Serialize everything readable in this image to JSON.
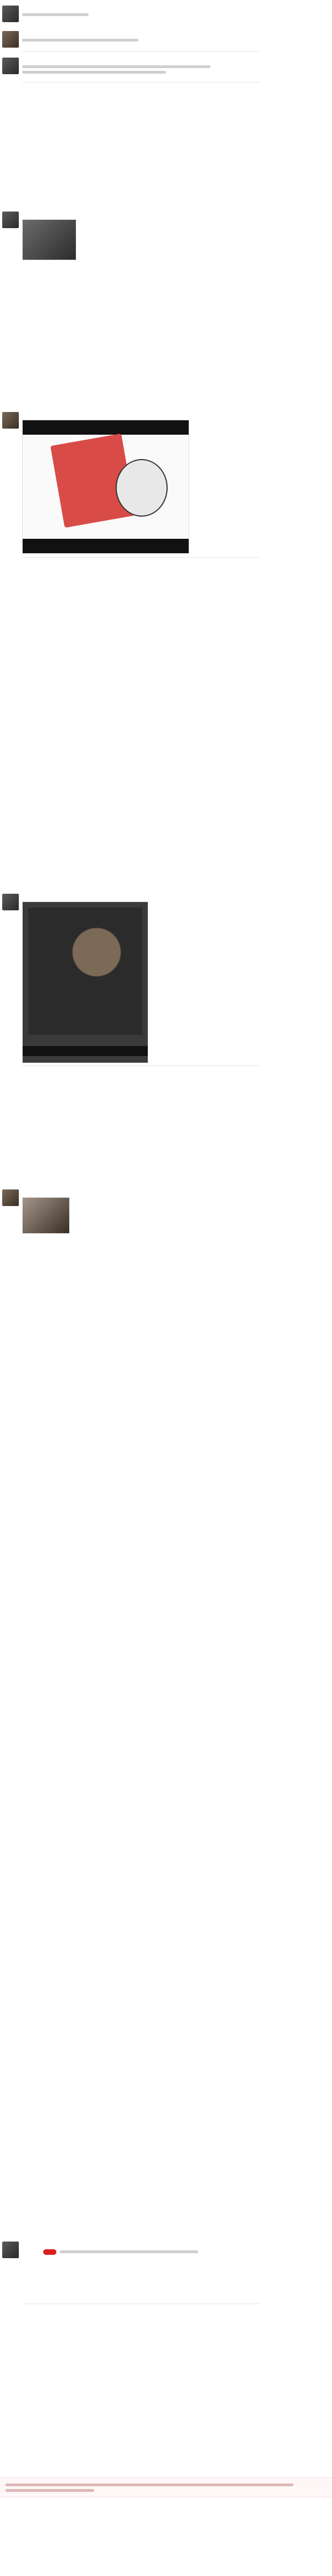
{
  "app": {
    "title": ""
  },
  "conversation": {
    "participants": [
      {
        "id": "p1",
        "display_name": ""
      },
      {
        "id": "p2",
        "display_name": ""
      }
    ],
    "messages": []
  },
  "media": {
    "images": [
      {
        "id": "img-1",
        "alt": "",
        "caption": ""
      },
      {
        "id": "img-2",
        "alt": "",
        "caption": ""
      },
      {
        "id": "img-3",
        "alt": "",
        "caption": ""
      },
      {
        "id": "img-4",
        "alt": "",
        "caption": ""
      }
    ]
  },
  "footer": {
    "notice": "",
    "watermark_left": "",
    "watermark_right": ""
  },
  "colors": {
    "link": "#2b587a",
    "muted": "#999999",
    "redact": "#d91f1f"
  }
}
